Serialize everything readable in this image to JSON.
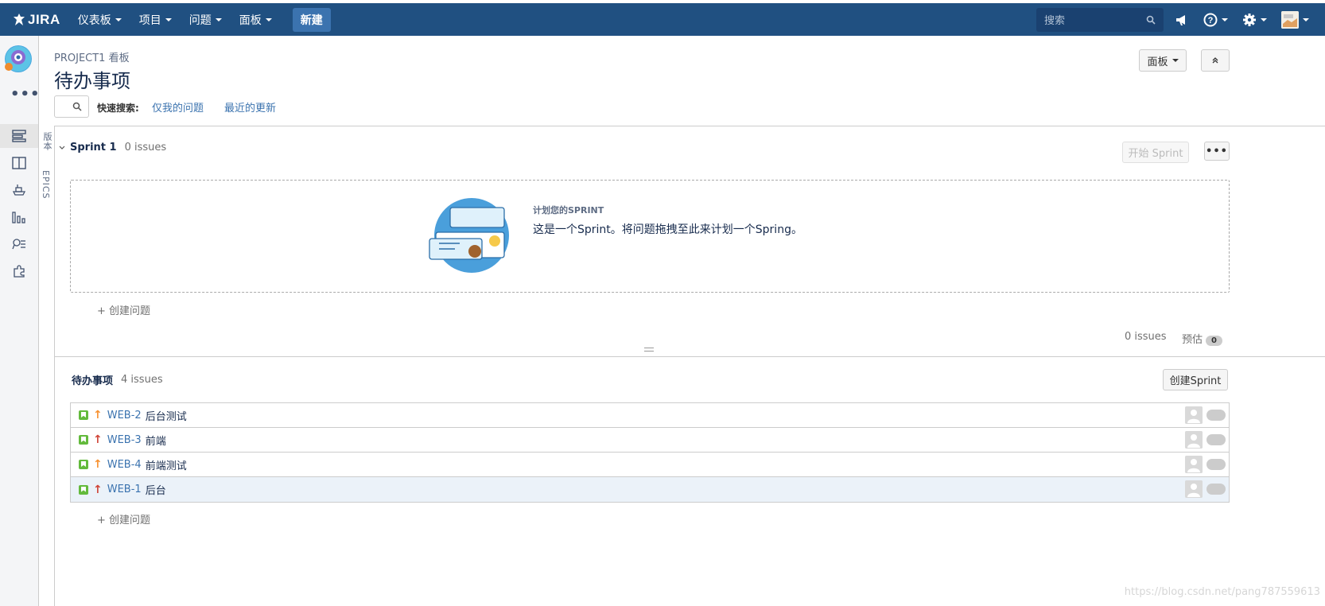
{
  "header": {
    "logo_text": "JIRA",
    "nav": [
      "仪表板",
      "项目",
      "问题",
      "面板"
    ],
    "create_label": "新建",
    "search_placeholder": "搜索"
  },
  "page": {
    "breadcrumb": "PROJECT1 看板",
    "title": "待办事项",
    "quick_search_label": "快速搜索:",
    "quick_filters": [
      "仅我的问题",
      "最近的更新"
    ],
    "board_button": "面板"
  },
  "side_tabs": [
    "版本",
    "EPICS"
  ],
  "sprint": {
    "name": "Sprint 1",
    "count": "0 issues",
    "start_button": "开始 Sprint",
    "plan_title": "计划您的SPRINT",
    "plan_desc": "这是一个Sprint。将问题拖拽至此来计划一个Spring。",
    "create_issue": "+ 创建问题",
    "footer_count": "0 issues",
    "estimate_label": "预估",
    "estimate_value": "0"
  },
  "backlog": {
    "name": "待办事项",
    "count": "4 issues",
    "create_sprint": "创建Sprint",
    "create_issue": "+ 创建问题",
    "issues": [
      {
        "key": "WEB-2",
        "summary": "后台测试",
        "priority_color": "#f79232",
        "selected": false
      },
      {
        "key": "WEB-3",
        "summary": "前端",
        "priority_color": "#d04437",
        "selected": false
      },
      {
        "key": "WEB-4",
        "summary": "前端测试",
        "priority_color": "#f79232",
        "selected": false
      },
      {
        "key": "WEB-1",
        "summary": "后台",
        "priority_color": "#d04437",
        "selected": true
      }
    ]
  },
  "watermark": "https://blog.csdn.net/pang787559613",
  "colors": {
    "header": "#205081",
    "create": "#3b73af",
    "link": "#3b73af",
    "story": "#63ba3c"
  }
}
